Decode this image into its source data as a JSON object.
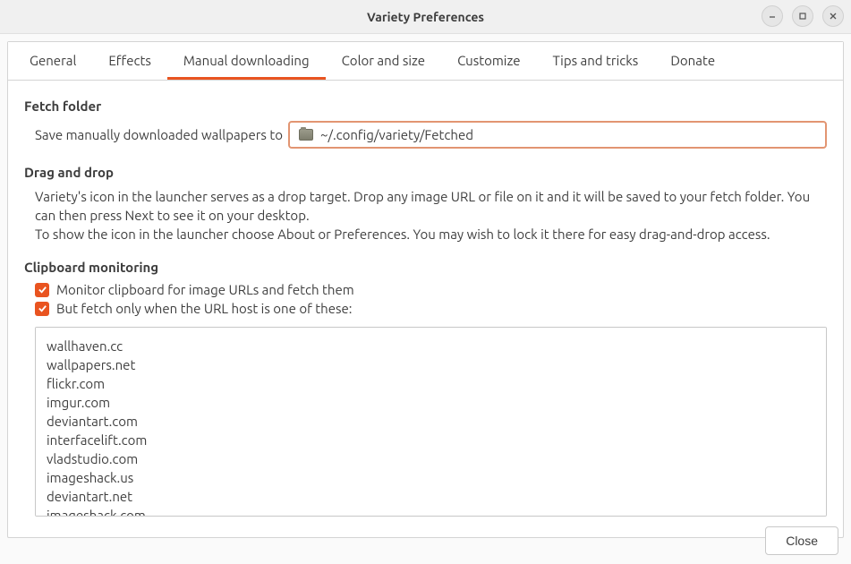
{
  "window": {
    "title": "Variety Preferences"
  },
  "tabs": [
    {
      "label": "General"
    },
    {
      "label": "Effects"
    },
    {
      "label": "Manual downloading"
    },
    {
      "label": "Color and size"
    },
    {
      "label": "Customize"
    },
    {
      "label": "Tips and tricks"
    },
    {
      "label": "Donate"
    }
  ],
  "fetch": {
    "heading": "Fetch folder",
    "label": "Save manually downloaded wallpapers to",
    "path": "~/.config/variety/Fetched"
  },
  "dragdrop": {
    "heading": "Drag and drop",
    "body": "Variety's icon in the launcher serves as a drop target. Drop any image URL or file on it and it will be saved to your fetch folder. You can then press Next to see it on your desktop.\nTo show the icon in the launcher choose About or Preferences. You may wish to lock it there for easy drag-and-drop access."
  },
  "clipboard": {
    "heading": "Clipboard monitoring",
    "opt1": "Monitor clipboard for image URLs and fetch them",
    "opt2": "But fetch only when the URL host is one of these:",
    "hosts": "wallhaven.cc\nwallpapers.net\nflickr.com\nimgur.com\ndeviantart.com\ninterfacelift.com\nvladstudio.com\nimageshack.us\ndeviantart.net\nimageshack.com"
  },
  "footer": {
    "close": "Close"
  }
}
